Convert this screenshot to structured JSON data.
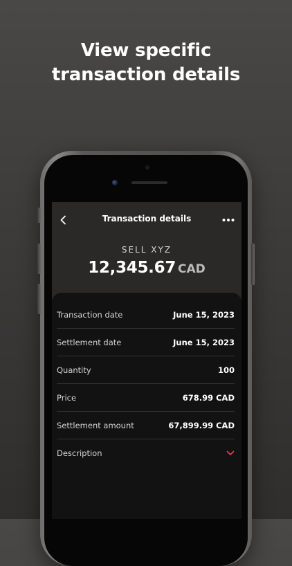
{
  "headline": {
    "line1": "View specific",
    "line2": "transaction details"
  },
  "nav": {
    "title": "Transaction details",
    "back_icon": "chevron-left-icon",
    "more_icon": "more-horizontal-icon"
  },
  "summary": {
    "label": "SELL XYZ",
    "amount": "12,345.67",
    "currency": "CAD"
  },
  "details": [
    {
      "label": "Transaction date",
      "value": "June 15, 2023"
    },
    {
      "label": "Settlement date",
      "value": "June 15, 2023"
    },
    {
      "label": "Quantity",
      "value": "100"
    },
    {
      "label": "Price",
      "value": "678.99 CAD"
    },
    {
      "label": "Settlement amount",
      "value": "67,899.99 CAD"
    },
    {
      "label": "Description",
      "value": ""
    }
  ],
  "colors": {
    "accent": "#e0474c",
    "background": "#3c3b3a",
    "screen_header": "#2a2928",
    "card": "#121212"
  }
}
